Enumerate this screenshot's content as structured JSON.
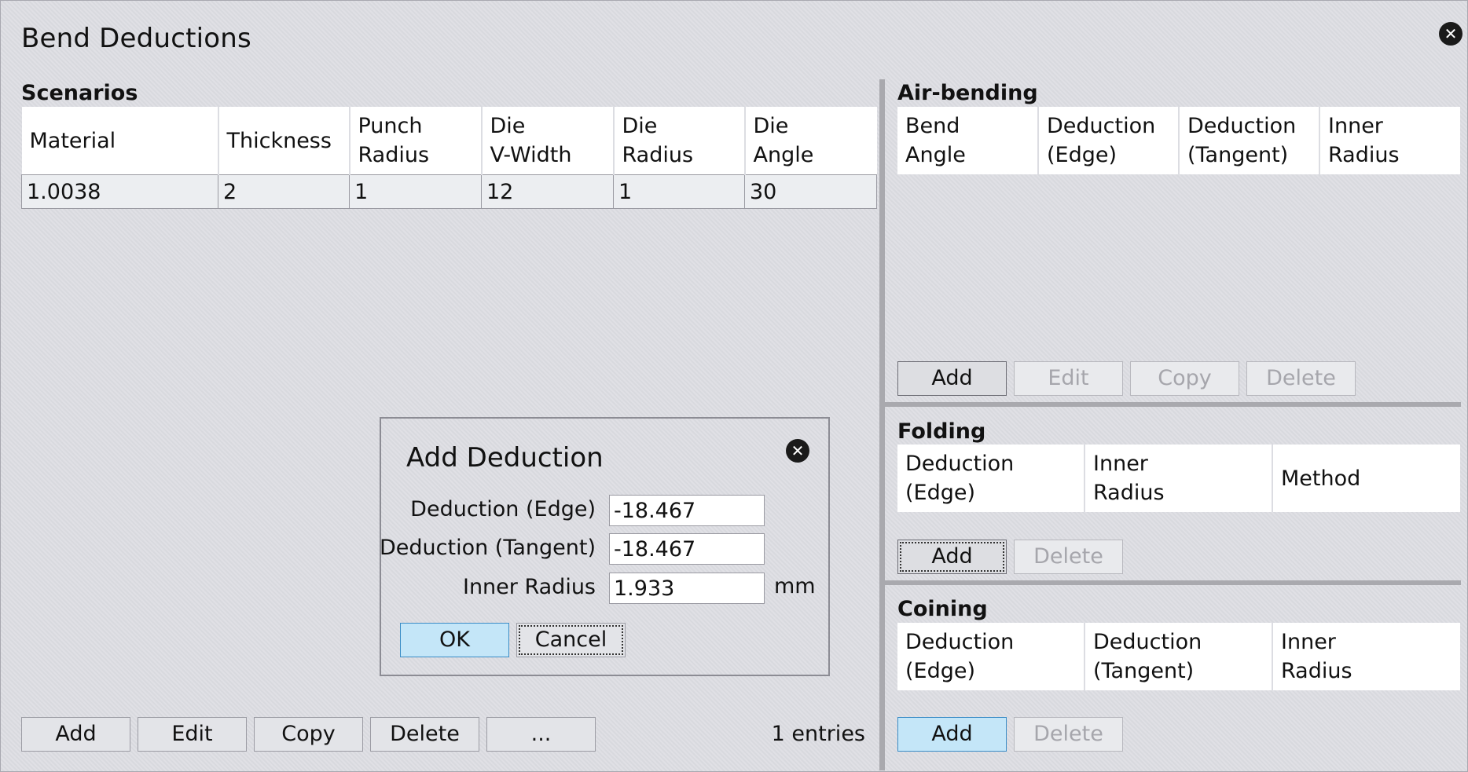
{
  "window": {
    "title": "Bend Deductions"
  },
  "scenarios": {
    "title": "Scenarios",
    "columns": [
      {
        "line1": "Material",
        "line2": ""
      },
      {
        "line1": "Thickness",
        "line2": ""
      },
      {
        "line1": "Punch",
        "line2": "Radius"
      },
      {
        "line1": "Die",
        "line2": "V-Width"
      },
      {
        "line1": "Die",
        "line2": "Radius"
      },
      {
        "line1": "Die",
        "line2": "Angle"
      }
    ],
    "rows": [
      [
        "1.0038",
        "2",
        "1",
        "12",
        "1",
        "30"
      ]
    ],
    "buttons": {
      "add": "Add",
      "edit": "Edit",
      "copy": "Copy",
      "delete": "Delete",
      "more": "..."
    },
    "entries": "1 entries"
  },
  "air_bending": {
    "title": "Air-bending",
    "columns": [
      {
        "line1": "Bend",
        "line2": "Angle"
      },
      {
        "line1": "Deduction",
        "line2": "(Edge)"
      },
      {
        "line1": "Deduction",
        "line2": "(Tangent)"
      },
      {
        "line1": "Inner",
        "line2": "Radius"
      }
    ],
    "buttons": {
      "add": "Add",
      "edit": "Edit",
      "copy": "Copy",
      "delete": "Delete"
    }
  },
  "folding": {
    "title": "Folding",
    "columns": [
      {
        "line1": "Deduction",
        "line2": "(Edge)"
      },
      {
        "line1": "Inner",
        "line2": "Radius"
      },
      {
        "line1": "Method",
        "line2": ""
      }
    ],
    "buttons": {
      "add": "Add",
      "delete": "Delete"
    }
  },
  "coining": {
    "title": "Coining",
    "columns": [
      {
        "line1": "Deduction",
        "line2": "(Edge)"
      },
      {
        "line1": "Deduction",
        "line2": "(Tangent)"
      },
      {
        "line1": "Inner",
        "line2": "Radius"
      }
    ],
    "buttons": {
      "add": "Add",
      "delete": "Delete"
    }
  },
  "dialog": {
    "title": "Add Deduction",
    "fields": {
      "edge": {
        "label": "Deduction (Edge)",
        "value": "-18.467"
      },
      "tangent": {
        "label": "Deduction (Tangent)",
        "value": "-18.467"
      },
      "radius": {
        "label": "Inner Radius",
        "value": "1.933",
        "unit": "mm"
      }
    },
    "ok": "OK",
    "cancel": "Cancel"
  },
  "icons": {
    "close": "close-icon"
  },
  "colors": {
    "background": "#dcdde2",
    "accent": "#c4e6f8",
    "accent_border": "#3a8cc6"
  }
}
